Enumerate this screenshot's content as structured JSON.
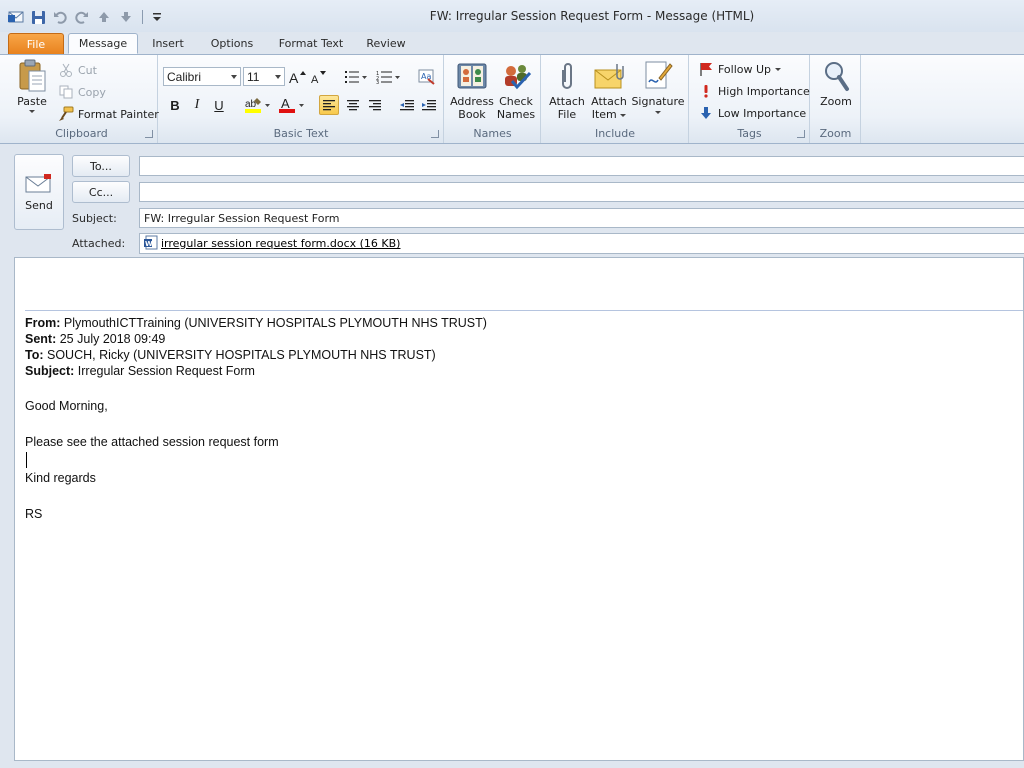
{
  "window": {
    "title": "FW: Irregular Session Request Form  -  Message (HTML)"
  },
  "tabs": [
    {
      "label": "File"
    },
    {
      "label": "Message"
    },
    {
      "label": "Insert"
    },
    {
      "label": "Options"
    },
    {
      "label": "Format Text"
    },
    {
      "label": "Review"
    }
  ],
  "ribbon": {
    "clipboard": {
      "label": "Clipboard",
      "paste": "Paste",
      "cut": "Cut",
      "copy": "Copy",
      "format_painter": "Format Painter"
    },
    "basic_text": {
      "label": "Basic Text",
      "font": "Calibri",
      "size": "11",
      "bold": "B",
      "italic": "I",
      "underline": "U"
    },
    "names": {
      "label": "Names",
      "address_book_1": "Address",
      "address_book_2": "Book",
      "check_names_1": "Check",
      "check_names_2": "Names"
    },
    "include": {
      "label": "Include",
      "attach_file_1": "Attach",
      "attach_file_2": "File",
      "attach_item_1": "Attach",
      "attach_item_2": "Item",
      "signature": "Signature"
    },
    "tags": {
      "label": "Tags",
      "follow_up": "Follow Up",
      "high_importance": "High Importance",
      "low_importance": "Low Importance"
    },
    "zoom": {
      "label": "Zoom",
      "zoom": "Zoom"
    }
  },
  "header": {
    "send": "Send",
    "to_button": "To...",
    "cc_button": "Cc...",
    "to_value": "",
    "cc_value": "",
    "subject_label": "Subject:",
    "subject_value": "FW: Irregular Session Request Form",
    "attached_label": "Attached:",
    "attachment": "irregular session request form.docx (16 KB)"
  },
  "body": {
    "from_label": "From:",
    "from_value": "PlymouthICTTraining (UNIVERSITY HOSPITALS PLYMOUTH NHS TRUST)",
    "sent_label": "Sent:",
    "sent_value": "25 July 2018 09:49",
    "to_label": "To:",
    "to_value": "SOUCH, Ricky (UNIVERSITY HOSPITALS PLYMOUTH NHS TRUST)",
    "subject_label": "Subject:",
    "subject_value": "Irregular Session Request Form",
    "greeting": "Good Morning,",
    "message": "Please see the attached session request form",
    "closing": "Kind regards",
    "signature": "RS"
  },
  "colors": {
    "file_tab": "#e8821e",
    "link": "#000000",
    "highlight_button": "#f8c94c"
  }
}
